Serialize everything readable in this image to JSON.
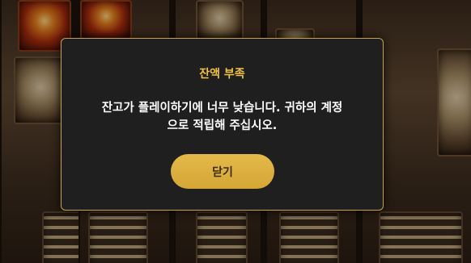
{
  "dialog": {
    "title": "잔액 부족",
    "message_line1": "잔고가 플레이하기에 너무 낮습니다. 귀하의 계정",
    "message_line2": "으로 적립해 주십시오.",
    "close_label": "닫기"
  },
  "colors": {
    "accent_gold": "#f0c14b",
    "button_gold": "#d8ab3a",
    "modal_bg": "#1f1f1f",
    "border_gold": "#c8a24a"
  }
}
